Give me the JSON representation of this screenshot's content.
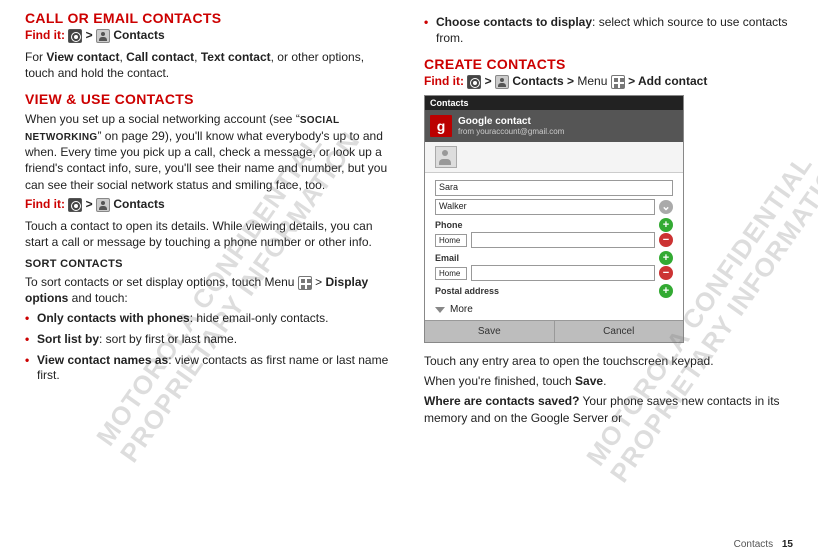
{
  "left": {
    "h_call_email": "CALL OR EMAIL CONTACTS",
    "findit": "Find it:",
    "contacts_label": "Contacts",
    "p_view_contact": "For <b>View contact</b>, <b>Call contact</b>, <b>Text contact</b>, or other options, touch and hold the contact.",
    "h_view_use": "VIEW & USE CONTACTS",
    "p_social_1a": "When you set up a social networking account (see “",
    "p_social_sc": "SOCIAL NETWORKING",
    "p_social_1b": "” on page 29), you'll know what everybody's up to and when. Every time you pick up a call, check a message, or look up a friend's contact info, sure, you'll see their name and number, but you can see their social network status and smiling face, too.",
    "p_touch_contact": "Touch a contact to open its details. While viewing details, you can start a call or message by touching a phone number or other info.",
    "h_sort": "SORT CONTACTS",
    "p_sort_intro_a": "To sort contacts or set display options, touch Menu",
    "p_sort_intro_b": "> ",
    "display_options": "Display options",
    "p_sort_intro_c": " and touch:",
    "bullets": {
      "b1_bold": "Only contacts with phones",
      "b1_rest": ": hide email-only contacts.",
      "b2_bold": "Sort list by",
      "b2_rest": ": sort by first or last name.",
      "b3_bold": "View contact names as",
      "b3_rest": ": view contacts as first name or last name first."
    }
  },
  "right": {
    "b_choose_bold": "Choose contacts to display",
    "b_choose_rest": ": select which source to use contacts from.",
    "h_create": "CREATE CONTACTS",
    "findit": "Find it:",
    "contacts_label": "Contacts",
    "menu_label": "Menu",
    "add_contact": "Add contact",
    "p_touch_entry": "Touch any entry area to open the touchscreen keypad.",
    "p_when_finished_a": "When you're finished, touch ",
    "p_when_finished_b": "Save",
    "p_when_finished_c": ".",
    "p_where_bold": "Where are contacts saved?",
    "p_where_rest": " Your phone saves new contacts in its memory and on the Google Server or"
  },
  "phone": {
    "title": "Contacts",
    "account_name": "Google contact",
    "account_sub": "from youraccount@gmail.com",
    "field1_value": "Sara",
    "field2_value": "Walker",
    "phone_label": "Phone",
    "phone_type": "Home",
    "email_label": "Email",
    "email_type": "Home",
    "postal_label": "Postal address",
    "more": "More",
    "save": "Save",
    "cancel": "Cancel"
  },
  "footer": {
    "section": "Contacts",
    "page": "15"
  },
  "watermark": "MOTOROLA CONFIDENTIAL\nPROPRIETARY INFORMATION"
}
